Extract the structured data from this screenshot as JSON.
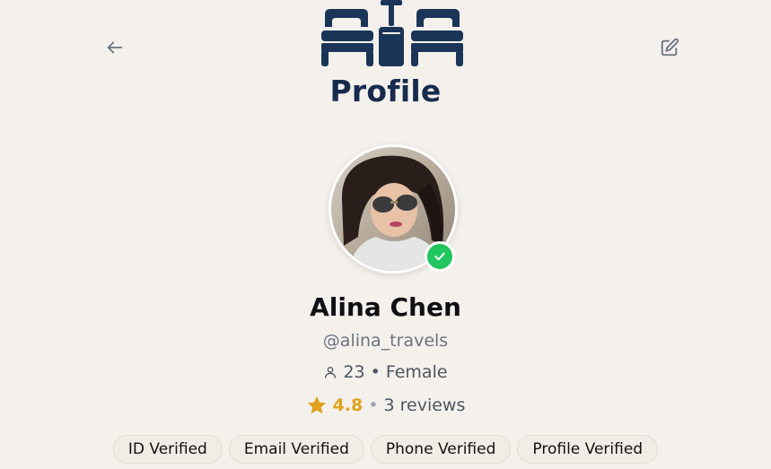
{
  "header": {
    "title": "Profile",
    "back_icon": "arrow-left-icon",
    "edit_icon": "edit-icon",
    "logo_icon": "beds-lamp-logo-icon"
  },
  "profile": {
    "name": "Alina Chen",
    "handle": "@alina_travels",
    "age": "23",
    "gender": "Female",
    "separator": "•",
    "rating": "4.8",
    "reviews": "3 reviews",
    "verified_icon": "check-icon"
  },
  "badges": [
    {
      "label": "ID Verified"
    },
    {
      "label": "Email Verified"
    },
    {
      "label": "Phone Verified"
    },
    {
      "label": "Profile Verified"
    }
  ],
  "colors": {
    "background": "#f4f1ec",
    "title": "#172b4d",
    "rating": "#e0a21b",
    "verified": "#22c55e",
    "logo": "#1b3558"
  }
}
